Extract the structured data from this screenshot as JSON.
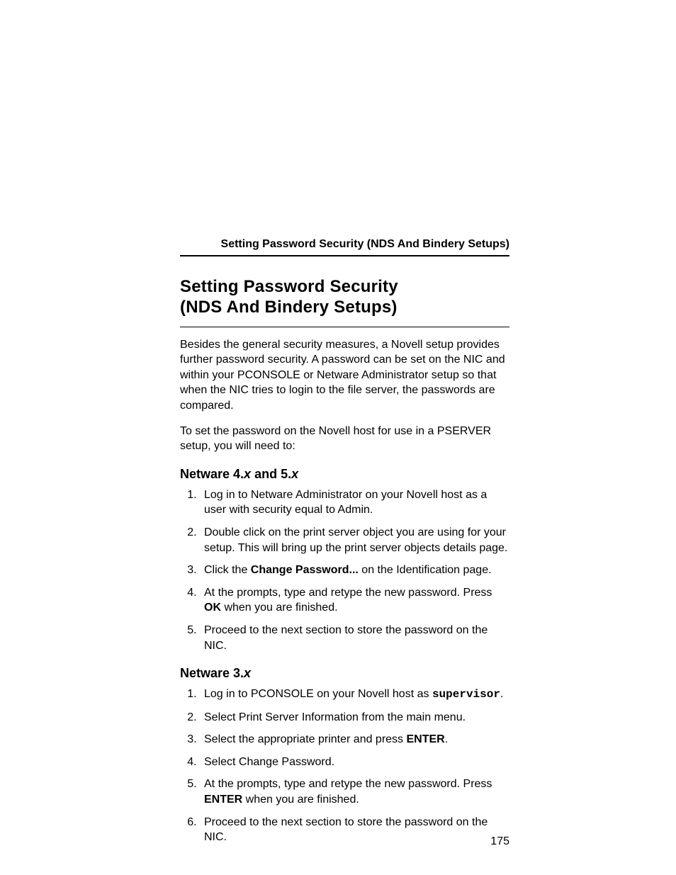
{
  "runningHead": "Setting Password Security (NDS And Bindery Setups)",
  "title": {
    "line1": "Setting Password Security",
    "line2": "(NDS And Bindery Setups)"
  },
  "intro": {
    "p1": "Besides the general security measures, a Novell setup provides further password security. A password can be set on the NIC and within your PCONSOLE or Netware Administrator setup so that when the NIC tries to login to the file server, the passwords are compared.",
    "p2": "To set the password on the Novell host for use in a PSERVER setup, you will need to:"
  },
  "sectionA": {
    "heading_prefix": "Netware 4.",
    "heading_var1": "x",
    "heading_mid": " and 5.",
    "heading_var2": "x",
    "steps": {
      "s1": "Log in to Netware Administrator on your Novell host as a user with security equal to Admin.",
      "s2": "Double click on the print server object you are using for your setup. This will bring up the print server objects details page.",
      "s3a": "Click the ",
      "s3b_bold": "Change Password...",
      "s3c": " on the Identification page.",
      "s4a": "At the prompts, type and retype the new password. Press ",
      "s4b_bold": "OK",
      "s4c": " when you are finished.",
      "s5": "Proceed to the next section to store the password on the NIC."
    }
  },
  "sectionB": {
    "heading_prefix": "Netware 3.",
    "heading_var": "x",
    "steps": {
      "s1a": "Log in to PCONSOLE on your Novell host as ",
      "s1b_mono": "supervisor",
      "s1c": ".",
      "s2": "Select Print Server Information from the main menu.",
      "s3a": "Select the appropriate printer and press ",
      "s3b_bold": "ENTER",
      "s3c": ".",
      "s4": "Select Change Password.",
      "s5a": "At the prompts, type and retype the new password. Press ",
      "s5b_bold": "ENTER",
      "s5c": " when you are finished.",
      "s6": "Proceed to the next section to store the password on the NIC."
    }
  },
  "pageNumber": "175"
}
